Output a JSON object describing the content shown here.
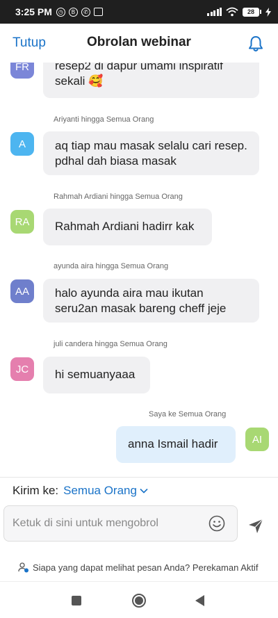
{
  "status_bar": {
    "time": "3:25 PM",
    "battery": "28",
    "icons": [
      "alarm-icon",
      "b-badge-icon",
      "whatsapp-icon",
      "gallery-icon",
      "signal-icon",
      "wifi-icon",
      "battery-icon",
      "charging-icon"
    ]
  },
  "header": {
    "close_label": "Tutup",
    "title": "Obrolan webinar",
    "bell_icon": "bell-icon"
  },
  "messages": [
    {
      "sender_meta": "",
      "initials": "FR",
      "avatar_color": "#7b86d8",
      "text": "resep2 di dapur umami inspiratif sekali 🥰",
      "mine": false
    },
    {
      "sender_meta": "Ariyanti hingga Semua Orang",
      "initials": "A",
      "avatar_color": "#4db5f0",
      "text": "aq tiap mau masak selalu cari resep. pdhal dah biasa masak",
      "mine": false
    },
    {
      "sender_meta": "Rahmah Ardiani hingga Semua Orang",
      "initials": "RA",
      "avatar_color": "#a8d873",
      "text": "Rahmah Ardiani hadirr kak",
      "mine": false
    },
    {
      "sender_meta": "ayunda aira hingga Semua Orang",
      "initials": "AA",
      "avatar_color": "#6f7fcc",
      "text": "halo ayunda aira mau ikutan seru2an masak bareng cheff  jeje",
      "mine": false
    },
    {
      "sender_meta": "juli candera hingga Semua Orang",
      "initials": "JC",
      "avatar_color": "#e57fae",
      "text": "hi semuanyaaa",
      "mine": false
    },
    {
      "sender_meta": "Saya ke Semua Orang",
      "initials": "AI",
      "avatar_color": "#a8d873",
      "text": "anna Ismail hadir",
      "mine": true
    }
  ],
  "send_to": {
    "label": "Kirim ke:",
    "target": "Semua Orang"
  },
  "composer": {
    "placeholder": "Ketuk di sini untuk mengobrol",
    "value": ""
  },
  "notice": {
    "text": "Siapa yang dapat melihat pesan Anda? Perekaman Aktif"
  },
  "colors": {
    "accent": "#1a73c8",
    "bubble": "#f0f0f2",
    "my_bubble": "#e0effc"
  }
}
